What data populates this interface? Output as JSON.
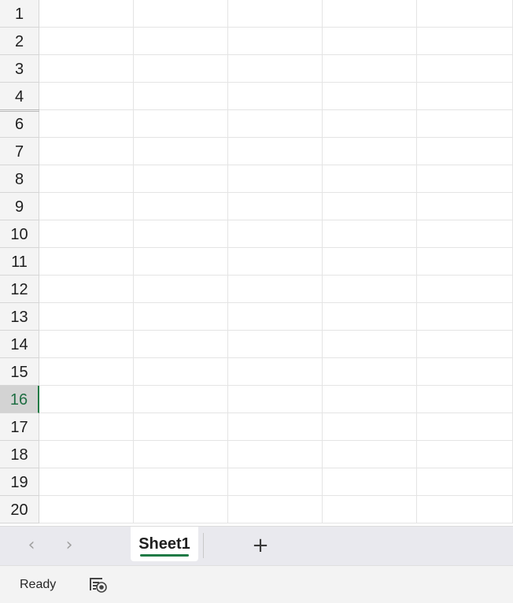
{
  "grid": {
    "rows": [
      "1",
      "2",
      "3",
      "4",
      "6",
      "7",
      "8",
      "9",
      "10",
      "11",
      "12",
      "13",
      "14",
      "15",
      "16",
      "17",
      "18",
      "19",
      "20"
    ],
    "selected_row": "16",
    "column_count": 5,
    "accent_color": "#1f7a45"
  },
  "tabbar": {
    "prev_icon": "chevron-left-icon",
    "next_icon": "chevron-right-icon",
    "sheets": [
      {
        "label": "Sheet1",
        "active": true
      }
    ],
    "add_icon": "plus-icon"
  },
  "status": {
    "text": "Ready",
    "icon": "accessibility-check-icon"
  }
}
